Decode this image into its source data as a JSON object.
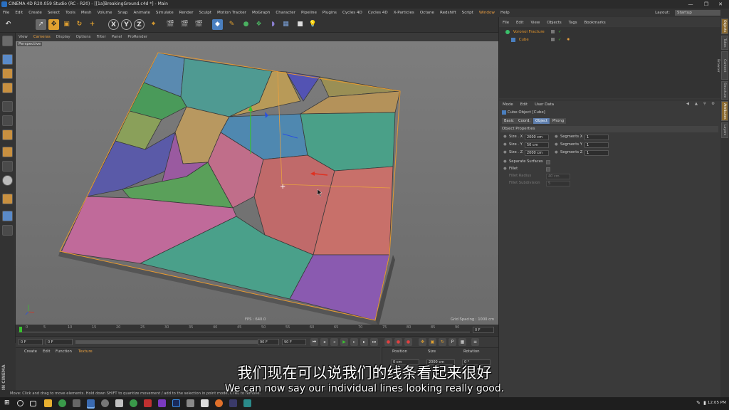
{
  "window": {
    "title": "CINEMA 4D R20.059 Studio (RC - R20) - [[1a]BreakingGround.c4d *] - Main",
    "minimize": "—",
    "restore": "❐",
    "close": "✕"
  },
  "menubar": {
    "items": [
      "File",
      "Edit",
      "Create",
      "Select",
      "Tools",
      "Mesh",
      "Volume",
      "Snap",
      "Animate",
      "Simulate",
      "Render",
      "Sculpt",
      "Motion Tracker",
      "MoGraph",
      "Character",
      "Pipeline",
      "Plugins",
      "Cycles 4D",
      "Cycles 4D",
      "X-Particles",
      "Octane",
      "Redshift",
      "Script",
      "Window",
      "Help"
    ],
    "layout_label": "Layout:",
    "layout_value": "Startup"
  },
  "toolbar": {
    "undo_icon": "undo-icon",
    "x_label": "X",
    "y_label": "Y",
    "z_label": "Z"
  },
  "viewport": {
    "menu": [
      "View",
      "Cameras",
      "Display",
      "Options",
      "Filter",
      "Panel",
      "ProRender"
    ],
    "label": "Perspective",
    "fps": "FPS : 640.0",
    "grid_spacing": "Grid Spacing : 1000 cm"
  },
  "timeline": {
    "ticks": [
      "0",
      "5",
      "10",
      "15",
      "20",
      "25",
      "30",
      "35",
      "40",
      "45",
      "50",
      "55",
      "60",
      "65",
      "70",
      "75",
      "80",
      "85",
      "90"
    ],
    "frame_end": "0 F"
  },
  "transport": {
    "start": "0 F",
    "current": "0 F",
    "end": "90 F",
    "end2": "90 F"
  },
  "material_manager": {
    "menu": [
      "Create",
      "Edit",
      "Function",
      "Texture"
    ]
  },
  "coord_manager": {
    "headers": [
      "Position",
      "Size",
      "Rotation"
    ],
    "row_values": [
      "0 cm",
      "2000 cm",
      "0 °"
    ]
  },
  "maxon": {
    "logo": "MAXON CINEMA 4D"
  },
  "statusbar": {
    "text": "Move: Click and drag to move elements. Hold down SHIFT to quantize movement / add to the selection in point mode, CTRL to remove."
  },
  "objects_panel": {
    "menu": [
      "File",
      "Edit",
      "View",
      "Objects",
      "Tags",
      "Bookmarks"
    ],
    "rows": [
      {
        "name": "Voronoi Fracture",
        "color": "#e6962a"
      },
      {
        "name": "Cube",
        "color": "#e6962a"
      }
    ]
  },
  "attributes_panel": {
    "menu": [
      "Mode",
      "Edit",
      "User Data"
    ],
    "object_title": "Cube Object [Cube]",
    "tabs": [
      "Basic",
      "Coord.",
      "Object",
      "Phong"
    ],
    "active_tab": "Object",
    "section": "Object Properties",
    "size_x_label": "Size . X",
    "size_x": "2000 cm",
    "size_y_label": "Size . Y",
    "size_y": "50 cm",
    "size_z_label": "Size . Z",
    "size_z": "2000 cm",
    "seg_x_label": "Segments X",
    "seg_x": "1",
    "seg_y_label": "Segments Y",
    "seg_y": "1",
    "seg_z_label": "Segments Z",
    "seg_z": "1",
    "separate_surfaces": "Separate Surfaces",
    "fillet": "Fillet",
    "fillet_radius_label": "Fillet Radius",
    "fillet_radius": "40 cm",
    "fillet_subdiv_label": "Fillet Subdivision",
    "fillet_subdiv": "5"
  },
  "right_strip_tabs": [
    "Objects",
    "Takes",
    "Content Browser",
    "Structure",
    "Attributes",
    "Layers"
  ],
  "taskbar": {
    "clock": "12:05 PM"
  },
  "subtitles": {
    "zh": "我们现在可以说我们的线条看起来很好",
    "en": "We can now say our individual lines looking really good."
  }
}
